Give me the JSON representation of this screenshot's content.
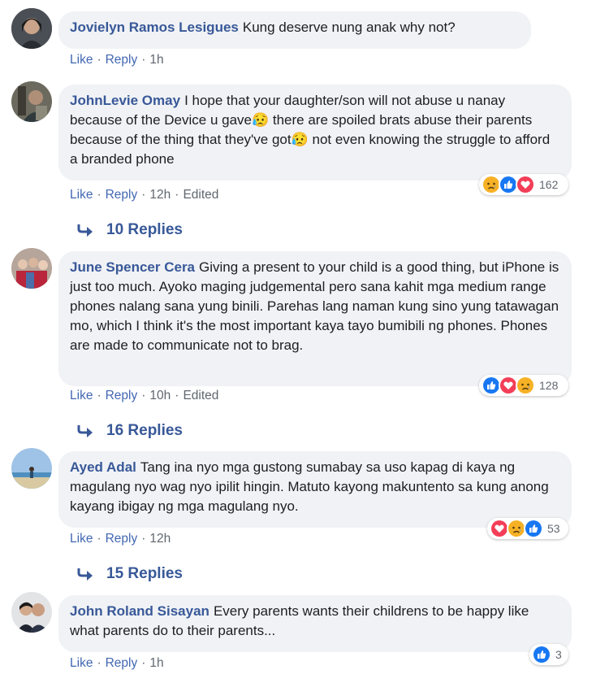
{
  "labels": {
    "like": "Like",
    "reply": "Reply"
  },
  "comments": [
    {
      "author": "Jovielyn Ramos Lesigues",
      "text": "Kung deserve nung anak why not?",
      "time": "1h",
      "edited": "",
      "reaction_count": "",
      "replies_label": ""
    },
    {
      "author": "JohnLevie Omay",
      "text": "I hope that your daughter/son will not abuse u nanay because of the Device u gave😥 there are spoiled brats abuse their parents because of the thing that they've got😥 not even knowing the struggle to afford a branded phone",
      "time": "12h",
      "edited": "Edited",
      "reaction_icons": [
        "sad-icon",
        "like-icon",
        "love-icon"
      ],
      "reaction_count": "162",
      "replies_label": "10 Replies"
    },
    {
      "author": "June Spencer Cera",
      "text": "Giving a present to your child is a good thing, but iPhone is just too much. Ayoko maging judgemental pero sana kahit mga medium range phones nalang sana yung binili. Parehas lang naman kung sino yung tatawagan mo, which I think it's the most important kaya tayo bumibili ng phones. Phones are made to communicate not to brag.",
      "time": "10h",
      "edited": "Edited",
      "reaction_icons": [
        "like-icon",
        "love-icon",
        "sad-icon"
      ],
      "reaction_count": "128",
      "replies_label": "16 Replies"
    },
    {
      "author": "Ayed Adal",
      "text": "Tang ina nyo mga gustong sumabay sa uso kapag di kaya ng magulang nyo wag nyo ipilit hingin. Matuto kayong makuntento sa kung anong kayang ibigay ng mga magulang nyo.",
      "time": "12h",
      "edited": "",
      "reaction_icons": [
        "love-icon",
        "sad-icon",
        "like-icon"
      ],
      "reaction_count": "53",
      "replies_label": "15 Replies"
    },
    {
      "author": "John Roland Sisayan",
      "text": "Every parents wants their childrens to be happy like what parents do to their parents...",
      "time": "1h",
      "edited": "",
      "reaction_icons": [
        "like-icon"
      ],
      "reaction_count": "3",
      "replies_label": ""
    }
  ],
  "colors": {
    "author": "#385898",
    "link": "#4267b2",
    "bubble": "#f0f2f5",
    "like": "#1877f2",
    "love": "#f33e58",
    "sad": "#f7b125"
  }
}
